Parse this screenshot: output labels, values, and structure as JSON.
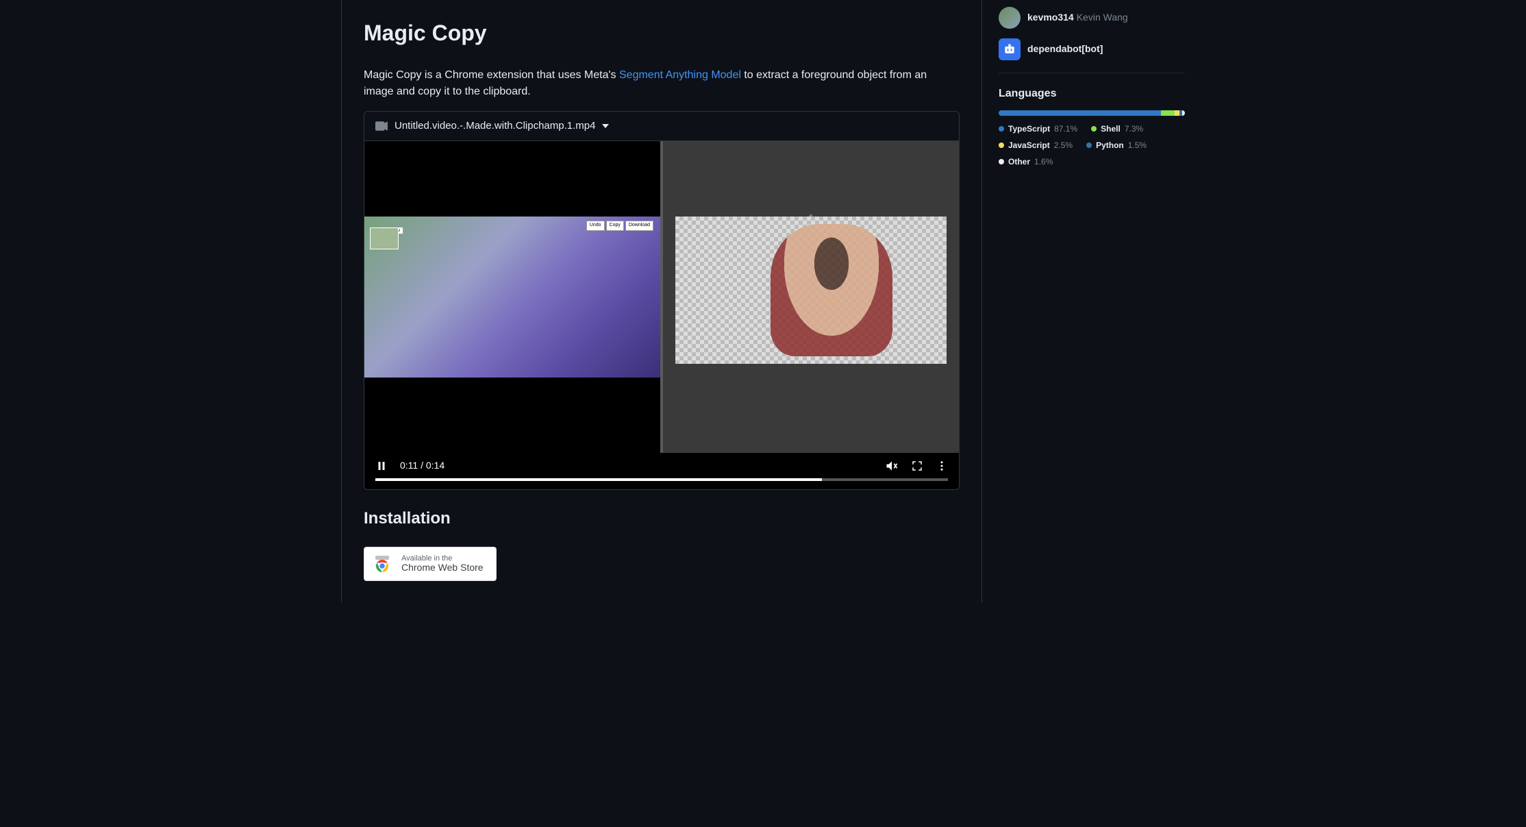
{
  "readme": {
    "title": "Magic Copy",
    "description_pre": "Magic Copy is a Chrome extension that uses Meta's ",
    "description_link": "Segment Anything Model",
    "description_post": " to extract a foreground object from an image and copy it to the clipboard.",
    "installation_heading": "Installation"
  },
  "video": {
    "filename": "Untitled.video.-.Made.with.Clipchamp.1.mp4",
    "current_time": "0:11",
    "duration": "0:14",
    "time_display": "0:11 / 0:14",
    "progress_pct": 78,
    "overlay_preview": "Preview",
    "overlay_undo": "Undo",
    "overlay_copy": "Copy",
    "overlay_download": "Download"
  },
  "cws": {
    "line1": "Available in the",
    "line2": "Chrome Web Store"
  },
  "contributors": [
    {
      "username": "kevmo314",
      "fullname": "Kevin Wang",
      "bot": false
    },
    {
      "username": "dependabot[bot]",
      "fullname": "",
      "bot": true
    }
  ],
  "languages": {
    "heading": "Languages",
    "items": [
      {
        "name": "TypeScript",
        "pct": "87.1%",
        "color": "#3178c6"
      },
      {
        "name": "Shell",
        "pct": "7.3%",
        "color": "#89e051"
      },
      {
        "name": "JavaScript",
        "pct": "2.5%",
        "color": "#f1e05a"
      },
      {
        "name": "Python",
        "pct": "1.5%",
        "color": "#3572A5"
      },
      {
        "name": "Other",
        "pct": "1.6%",
        "color": "#ededed"
      }
    ]
  }
}
